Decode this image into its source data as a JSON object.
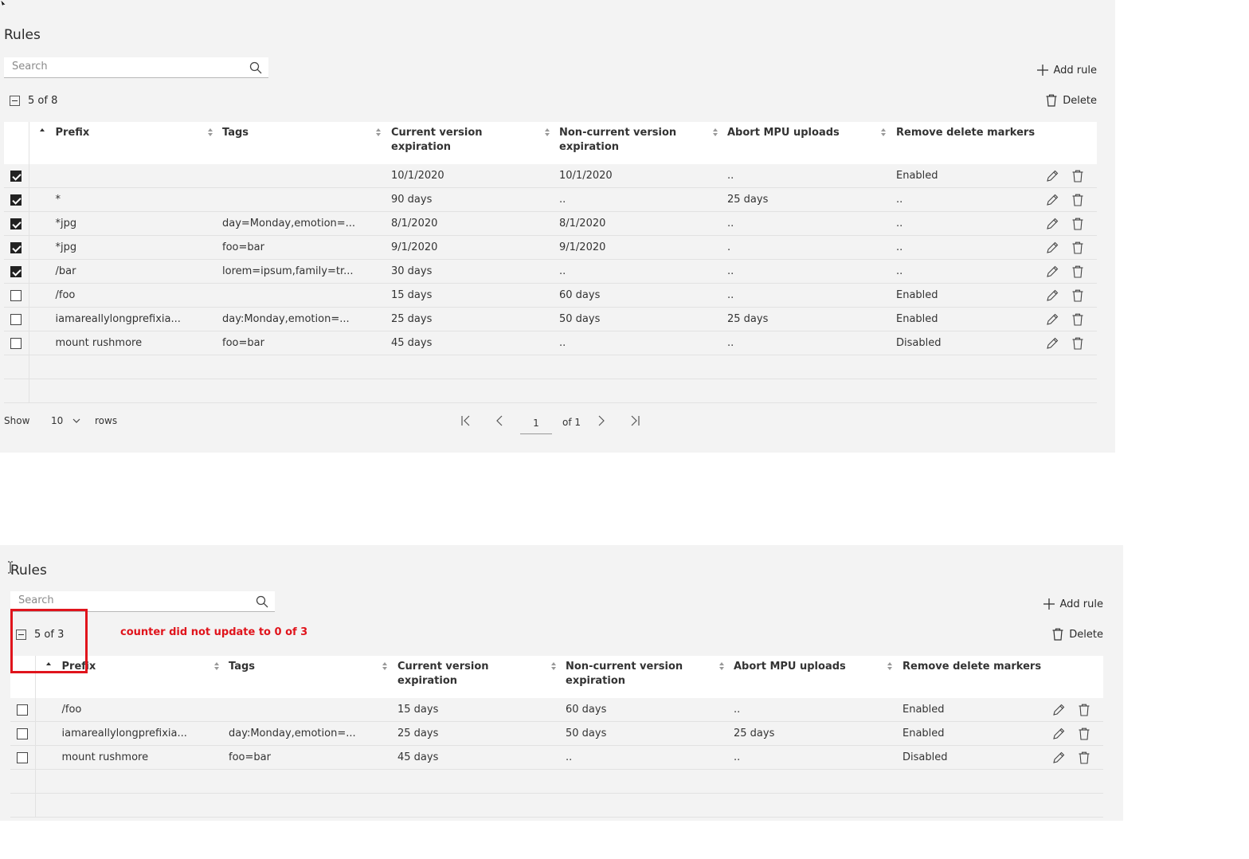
{
  "top": {
    "title": "Rules",
    "search_placeholder": "Search",
    "add_rule": "Add rule",
    "delete": "Delete",
    "counter": "5 of 8",
    "columns": [
      "Prefix",
      "Tags",
      "Current version expiration",
      "Non-current version expiration",
      "Abort MPU uploads",
      "Remove delete markers"
    ],
    "rows": [
      {
        "checked": true,
        "prefix": "",
        "tags": "",
        "current": "10/1/2020",
        "noncurrent": "10/1/2020",
        "abort": "..",
        "remove": "Enabled"
      },
      {
        "checked": true,
        "prefix": "*",
        "tags": "",
        "current": "90 days",
        "noncurrent": "..",
        "abort": "25 days",
        "remove": ".."
      },
      {
        "checked": true,
        "prefix": "*jpg",
        "tags": "day=Monday,emotion=...",
        "current": "8/1/2020",
        "noncurrent": "8/1/2020",
        "abort": "..",
        "remove": ".."
      },
      {
        "checked": true,
        "prefix": "*jpg",
        "tags": "foo=bar",
        "current": "9/1/2020",
        "noncurrent": "9/1/2020",
        "abort": ".",
        "remove": ".."
      },
      {
        "checked": true,
        "prefix": "/bar",
        "tags": "lorem=ipsum,family=tr...",
        "current": "30 days",
        "noncurrent": "..",
        "abort": "..",
        "remove": ".."
      },
      {
        "checked": false,
        "prefix": "/foo",
        "tags": "",
        "current": "15 days",
        "noncurrent": "60 days",
        "abort": "..",
        "remove": "Enabled"
      },
      {
        "checked": false,
        "prefix": "iamareallylongprefixia...",
        "tags": "day:Monday,emotion=...",
        "current": "25 days",
        "noncurrent": "50 days",
        "abort": "25 days",
        "remove": "Enabled"
      },
      {
        "checked": false,
        "prefix": "mount rushmore",
        "tags": "foo=bar",
        "current": "45 days",
        "noncurrent": "..",
        "abort": "..",
        "remove": "Disabled"
      }
    ],
    "pagination": {
      "show": "Show",
      "rows_value": "10",
      "rows": "rows",
      "page": "1",
      "of": "of 1"
    }
  },
  "bottom": {
    "title": "Rules",
    "search_placeholder": "Search",
    "add_rule": "Add rule",
    "delete": "Delete",
    "counter": "5 of 3",
    "columns": [
      "Prefix",
      "Tags",
      "Current version expiration",
      "Non-current version expiration",
      "Abort MPU uploads",
      "Remove delete markers"
    ],
    "rows": [
      {
        "checked": false,
        "prefix": "/foo",
        "tags": "",
        "current": "15 days",
        "noncurrent": "60 days",
        "abort": "..",
        "remove": "Enabled"
      },
      {
        "checked": false,
        "prefix": "iamareallylongprefixia...",
        "tags": "day:Monday,emotion=...",
        "current": "25 days",
        "noncurrent": "50 days",
        "abort": "25 days",
        "remove": "Enabled"
      },
      {
        "checked": false,
        "prefix": "mount rushmore",
        "tags": "foo=bar",
        "current": "45 days",
        "noncurrent": "..",
        "abort": "..",
        "remove": "Disabled"
      }
    ]
  },
  "annotation": {
    "text": "counter did not update to 0 of 3",
    "color": "#e0141c"
  },
  "icons": {
    "search": "search-icon",
    "add": "plus-icon",
    "delete": "trash-icon",
    "edit": "pencil-icon"
  }
}
